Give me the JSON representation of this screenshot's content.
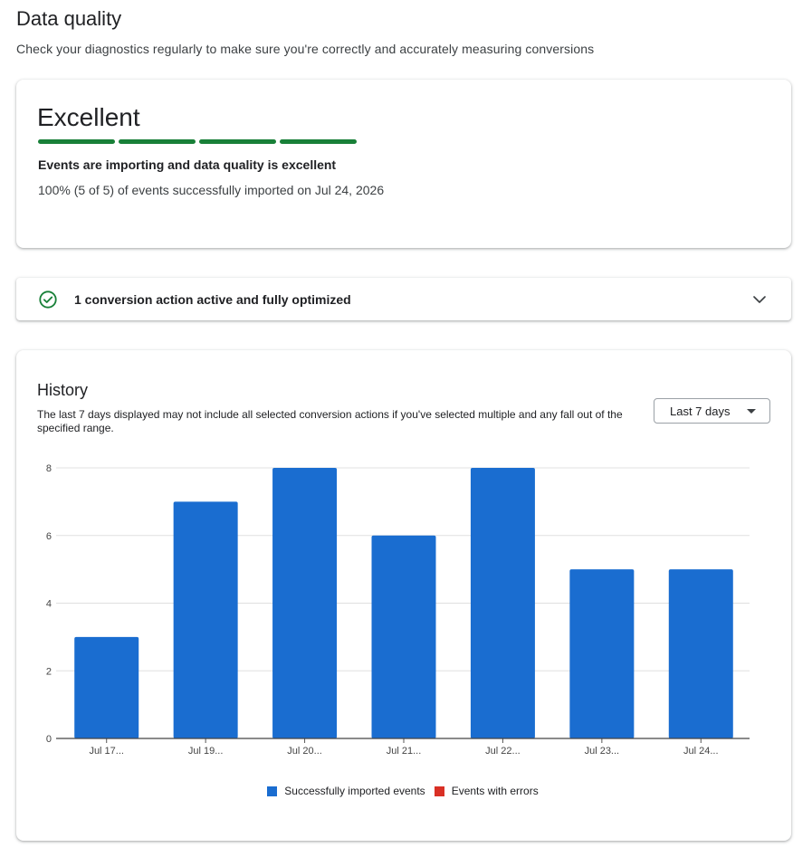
{
  "header": {
    "title": "Data quality",
    "subtitle": "Check your diagnostics regularly to make sure you're correctly and accurately measuring conversions"
  },
  "quality": {
    "label": "Excellent",
    "bars_filled": 4,
    "bars_total": 4,
    "bar_color": "#188038",
    "headline": "Events are importing and data quality is excellent",
    "detail": "100% (5 of 5) of events successfully imported on Jul 24, 2026"
  },
  "conversion": {
    "icon": "check-circle-icon",
    "text": "1 conversion action active and fully optimized",
    "expand_icon": "chevron-down-icon"
  },
  "history": {
    "title": "History",
    "description": "The last 7 days displayed may not include all selected conversion actions if you've selected multiple and any fall out of the specified range.",
    "range_select": "Last 7 days"
  },
  "chart_data": {
    "type": "bar",
    "categories": [
      "Jul 17...",
      "Jul 19...",
      "Jul 20...",
      "Jul 21...",
      "Jul 22...",
      "Jul 23...",
      "Jul 24..."
    ],
    "series": [
      {
        "name": "Successfully imported events",
        "color": "#1a6dd0",
        "values": [
          3,
          7,
          8,
          6,
          8,
          5,
          5
        ]
      },
      {
        "name": "Events with errors",
        "color": "#d93025",
        "values": [
          0,
          0,
          0,
          0,
          0,
          0,
          0
        ]
      }
    ],
    "yticks": [
      0,
      2,
      4,
      6,
      8
    ],
    "ylim": [
      0,
      8
    ],
    "grid": true,
    "legend": "bottom"
  }
}
